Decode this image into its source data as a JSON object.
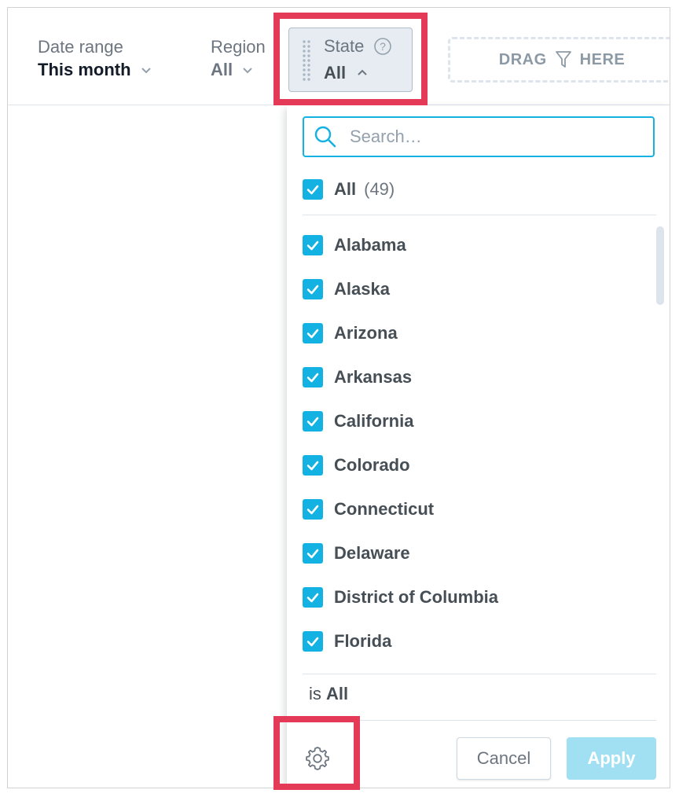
{
  "filters": {
    "date_range": {
      "label": "Date range",
      "value": "This month"
    },
    "region": {
      "label": "Region",
      "value": "All"
    },
    "state": {
      "label": "State",
      "value": "All"
    }
  },
  "drag_zone": {
    "text_left": "DRAG",
    "text_right": "HERE"
  },
  "dropdown": {
    "search_placeholder": "Search…",
    "all_label": "All",
    "all_count": "(49)",
    "items": [
      {
        "label": "Alabama",
        "checked": true
      },
      {
        "label": "Alaska",
        "checked": true
      },
      {
        "label": "Arizona",
        "checked": true
      },
      {
        "label": "Arkansas",
        "checked": true
      },
      {
        "label": "California",
        "checked": true
      },
      {
        "label": "Colorado",
        "checked": true
      },
      {
        "label": "Connecticut",
        "checked": true
      },
      {
        "label": "Delaware",
        "checked": true
      },
      {
        "label": "District of Columbia",
        "checked": true
      },
      {
        "label": "Florida",
        "checked": true
      }
    ],
    "summary_prefix": "is",
    "summary_value": "All",
    "cancel_label": "Cancel",
    "apply_label": "Apply"
  },
  "colors": {
    "accent": "#14b2e2",
    "apply_disabled": "#a1e0f3",
    "highlight": "#e43a57"
  },
  "icons": [
    "chevron-down-icon",
    "chevron-up-icon",
    "help-icon",
    "drag-grip-icon",
    "funnel-icon",
    "search-icon",
    "checkbox-checked-icon",
    "gear-icon"
  ]
}
